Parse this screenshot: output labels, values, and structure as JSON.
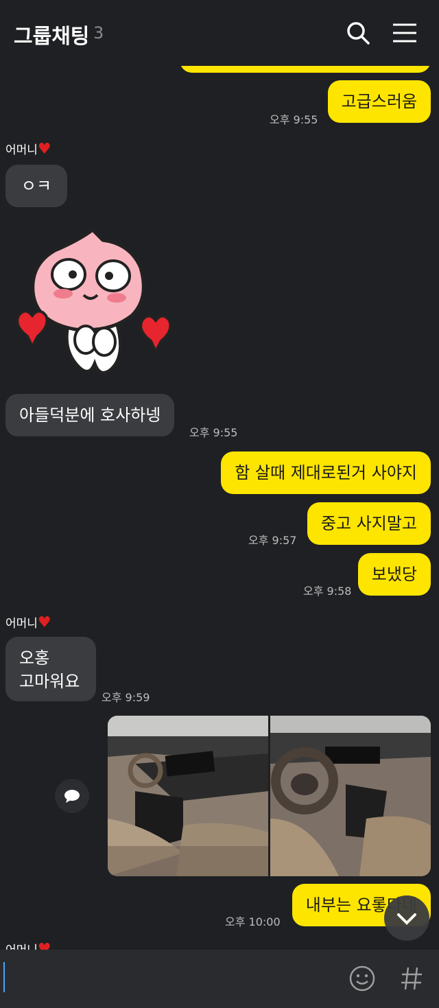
{
  "header": {
    "title": "그룹채팅",
    "member_count": "3",
    "icons": [
      "search-icon",
      "menu-icon"
    ]
  },
  "messages": [
    {
      "text": "고급스러움",
      "time": "오후 9:55",
      "from": "me"
    },
    {
      "sender": "어머니",
      "text": "ㅇㅋ",
      "from": "other"
    },
    {
      "sticker": "apeach-hearts-sticker",
      "from": "other"
    },
    {
      "text": "아들덕분에 호사하넹",
      "time": "오후 9:55",
      "from": "other"
    },
    {
      "text": "함 살때 제대로된거 사야지",
      "from": "me"
    },
    {
      "text": "중고 사지말고",
      "time": "오후 9:57",
      "from": "me"
    },
    {
      "text": "보냈당",
      "time": "오후 9:58",
      "from": "me"
    },
    {
      "sender": "어머니",
      "text": "오홍\n고마워요",
      "time": "오후 9:59",
      "from": "other"
    },
    {
      "photos": [
        "car-interior-dashboard",
        "car-interior-steering-wheel"
      ],
      "from": "me"
    },
    {
      "text": "내부는 요롷다네",
      "time": "오후 10:00",
      "from": "me"
    }
  ],
  "sender_label": "어머니",
  "input": {
    "value": ""
  },
  "colors": {
    "background": "#1f2023",
    "my_bubble": "#fee500",
    "other_bubble": "#3b3c40"
  }
}
